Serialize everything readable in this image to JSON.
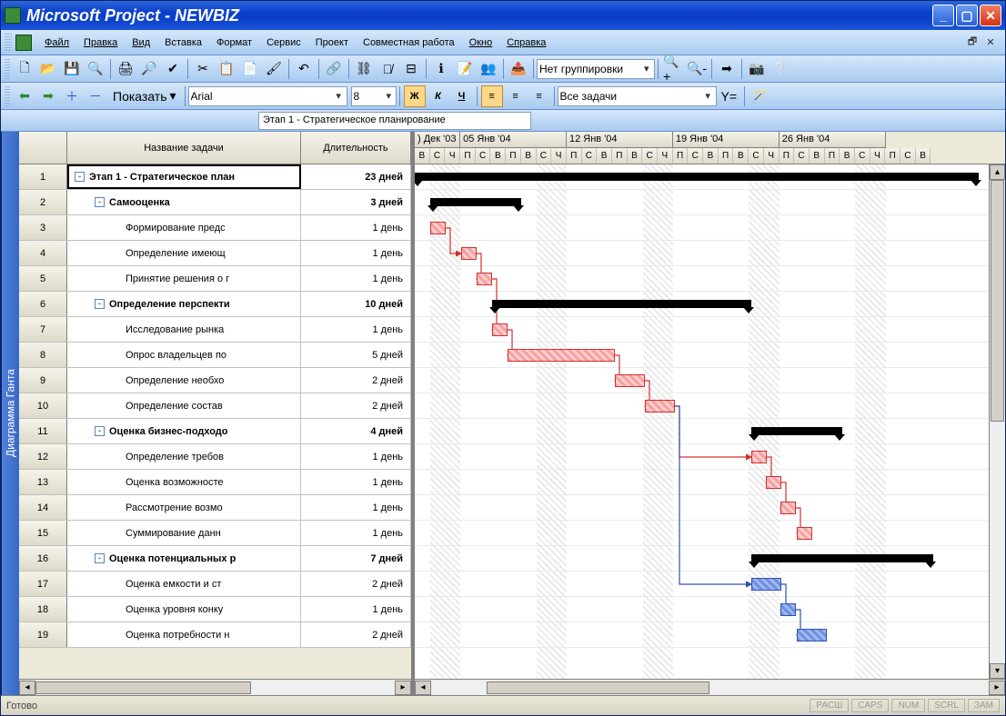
{
  "title": "Microsoft Project - NEWBIZ",
  "menus": {
    "file": "Файл",
    "edit": "Правка",
    "view": "Вид",
    "insert": "Вставка",
    "format": "Формат",
    "tools": "Сервис",
    "project": "Проект",
    "collab": "Совместная работа",
    "window": "Окно",
    "help": "Справка"
  },
  "toolbar1": {
    "group_combo": "Нет группировки"
  },
  "toolbar2": {
    "show_btn": "Показать",
    "font": "Arial",
    "size": "8",
    "bold": "Ж",
    "italic": "К",
    "underline": "Ч",
    "filter": "Все задачи",
    "yeq": "Y="
  },
  "formula_bar": "Этап 1 - Стратегическое планирование",
  "vtab": "Диаграмма Ганта",
  "columns": {
    "name": "Название задачи",
    "duration": "Длительность"
  },
  "timeline": {
    "weeks": [
      {
        "label": ") Дек '03",
        "days": 3
      },
      {
        "label": "05 Янв '04",
        "days": 7
      },
      {
        "label": "12 Янв '04",
        "days": 7
      },
      {
        "label": "19 Янв '04",
        "days": 7
      },
      {
        "label": "26 Янв '04",
        "days": 7
      }
    ],
    "day_labels": [
      "В",
      "С",
      "Ч",
      "П",
      "С",
      "В",
      "П",
      "В",
      "С",
      "Ч",
      "П",
      "С",
      "В",
      "П",
      "В",
      "С",
      "Ч",
      "П",
      "С",
      "В",
      "П",
      "В",
      "С",
      "Ч",
      "П",
      "С",
      "В",
      "П",
      "В",
      "С",
      "Ч",
      "П",
      "С",
      "В"
    ]
  },
  "tasks": [
    {
      "n": 1,
      "name": "Этап 1 - Стратегическое план",
      "dur": "23 дней",
      "bold": true,
      "indent": 0,
      "outline": "-",
      "type": "summary",
      "start": 0,
      "len": 620,
      "sel": true
    },
    {
      "n": 2,
      "name": "Самооценка",
      "dur": "3 дней",
      "bold": true,
      "indent": 1,
      "outline": "-",
      "type": "summary",
      "start": 17,
      "len": 100
    },
    {
      "n": 3,
      "name": "Формирование предс",
      "dur": "1 день",
      "bold": false,
      "indent": 2,
      "type": "red",
      "start": 17,
      "len": 17
    },
    {
      "n": 4,
      "name": "Определение имеющ",
      "dur": "1 день",
      "bold": false,
      "indent": 2,
      "type": "red",
      "start": 51,
      "len": 17
    },
    {
      "n": 5,
      "name": "Принятие решения о г",
      "dur": "1 день",
      "bold": false,
      "indent": 2,
      "type": "red",
      "start": 68,
      "len": 17
    },
    {
      "n": 6,
      "name": "Определение перспекти",
      "dur": "10 дней",
      "bold": true,
      "indent": 1,
      "outline": "-",
      "type": "summary",
      "start": 85,
      "len": 285
    },
    {
      "n": 7,
      "name": "Исследование рынка",
      "dur": "1 день",
      "bold": false,
      "indent": 2,
      "type": "red",
      "start": 85,
      "len": 17
    },
    {
      "n": 8,
      "name": "Опрос владельцев по",
      "dur": "5 дней",
      "bold": false,
      "indent": 2,
      "type": "red",
      "start": 102,
      "len": 118
    },
    {
      "n": 9,
      "name": "Определение необхо",
      "dur": "2 дней",
      "bold": false,
      "indent": 2,
      "type": "red",
      "start": 220,
      "len": 33
    },
    {
      "n": 10,
      "name": "Определение состав",
      "dur": "2 дней",
      "bold": false,
      "indent": 2,
      "type": "red",
      "start": 253,
      "len": 33
    },
    {
      "n": 11,
      "name": "Оценка бизнес-подходо",
      "dur": "4 дней",
      "bold": true,
      "indent": 1,
      "outline": "-",
      "type": "summary",
      "start": 370,
      "len": 100
    },
    {
      "n": 12,
      "name": "Определение требов",
      "dur": "1 день",
      "bold": false,
      "indent": 2,
      "type": "red",
      "start": 370,
      "len": 17
    },
    {
      "n": 13,
      "name": "Оценка возможносте",
      "dur": "1 день",
      "bold": false,
      "indent": 2,
      "type": "red",
      "start": 386,
      "len": 17
    },
    {
      "n": 14,
      "name": "Рассмотрение возмо",
      "dur": "1 день",
      "bold": false,
      "indent": 2,
      "type": "red",
      "start": 402,
      "len": 17
    },
    {
      "n": 15,
      "name": "Суммирование данн",
      "dur": "1 день",
      "bold": false,
      "indent": 2,
      "type": "red",
      "start": 420,
      "len": 17
    },
    {
      "n": 16,
      "name": "Оценка потенциальных р",
      "dur": "7 дней",
      "bold": true,
      "indent": 1,
      "outline": "-",
      "type": "summary",
      "start": 370,
      "len": 200
    },
    {
      "n": 17,
      "name": "Оценка емкости и ст",
      "dur": "2 дней",
      "bold": false,
      "indent": 2,
      "type": "blue",
      "start": 370,
      "len": 33
    },
    {
      "n": 18,
      "name": "Оценка уровня конку",
      "dur": "1 день",
      "bold": false,
      "indent": 2,
      "type": "blue",
      "start": 402,
      "len": 17
    },
    {
      "n": 19,
      "name": "Оценка потребности н",
      "dur": "2 дней",
      "bold": false,
      "indent": 2,
      "type": "blue",
      "start": 420,
      "len": 33
    }
  ],
  "status": {
    "ready": "Готово",
    "ind": [
      "РАСШ",
      "CAPS",
      "NUM",
      "SCRL",
      "ЗАМ"
    ]
  }
}
